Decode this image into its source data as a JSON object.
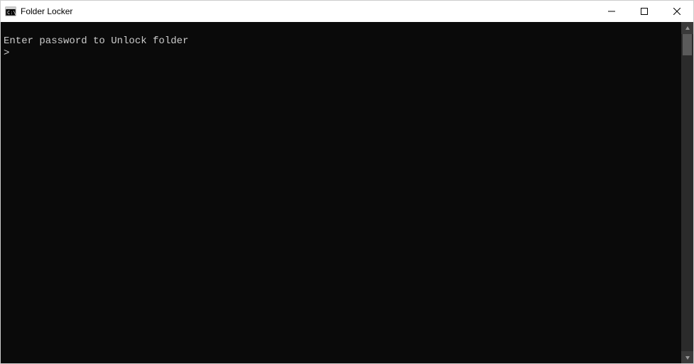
{
  "window": {
    "title": "Folder Locker"
  },
  "terminal": {
    "line1": "Enter password to Unlock folder",
    "prompt": ">"
  }
}
